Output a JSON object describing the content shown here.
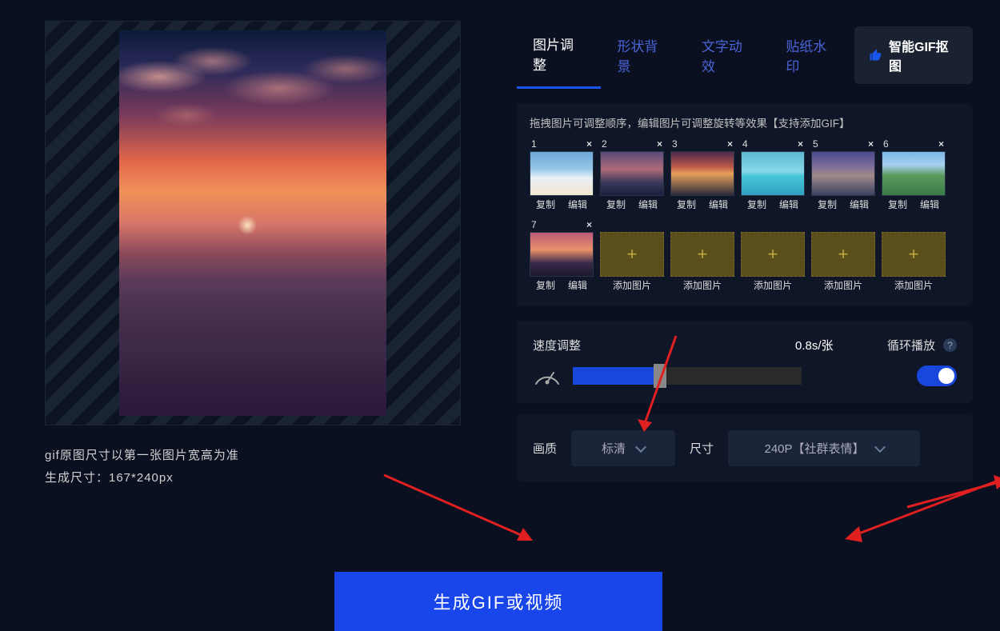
{
  "preview": {
    "dimensions_note": "gif原图尺寸以第一张图片宽高为准",
    "output_size": "生成尺寸：167*240px"
  },
  "tabs": {
    "items": [
      "图片调整",
      "形状背景",
      "文字动效",
      "贴纸水印"
    ],
    "active_index": 0,
    "smart_button": "智能GIF抠图"
  },
  "frames": {
    "hint": "拖拽图片可调整顺序，编辑图片可调整旋转等效果【支持添加GIF】",
    "items": [
      {
        "index": "1"
      },
      {
        "index": "2"
      },
      {
        "index": "3"
      },
      {
        "index": "4"
      },
      {
        "index": "5"
      },
      {
        "index": "6"
      },
      {
        "index": "7"
      }
    ],
    "close_glyph": "×",
    "copy_label": "复制",
    "edit_label": "编辑",
    "add_label": "添加图片",
    "plus_glyph": "+"
  },
  "speed": {
    "label": "速度调整",
    "value": "0.8s/张",
    "loop_label": "循环播放",
    "help_glyph": "?",
    "loop_on": true
  },
  "output": {
    "quality_label": "画质",
    "quality_value": "标清",
    "size_label": "尺寸",
    "size_value": "240P【社群表情】"
  },
  "generate_label": "生成GIF或视频"
}
